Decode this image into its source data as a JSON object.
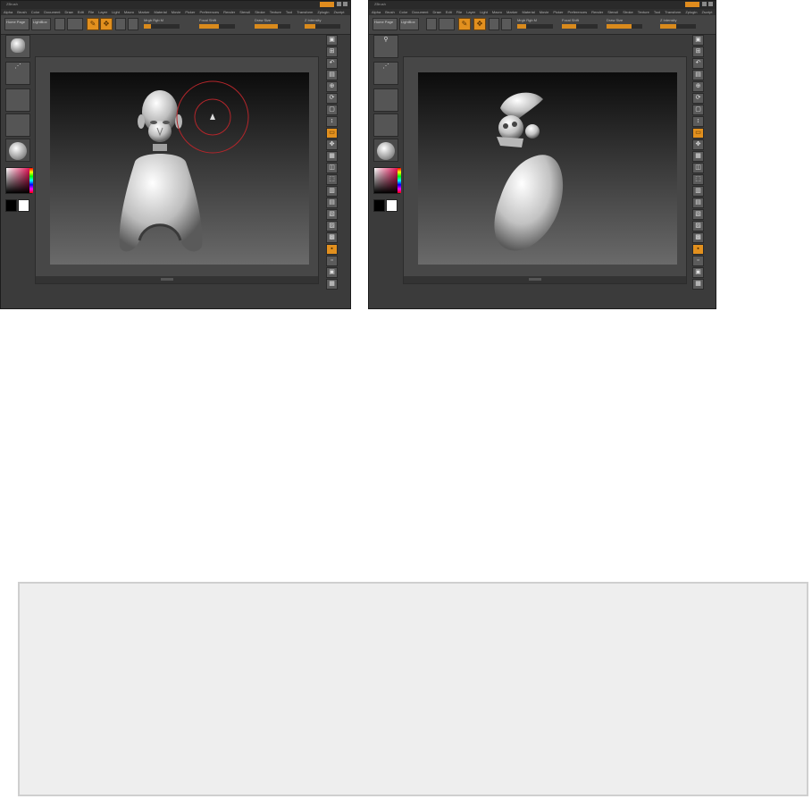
{
  "screenshots": [
    {
      "id": "left",
      "title": "ZBrush",
      "menu": [
        "Alpha",
        "Brush",
        "Color",
        "Document",
        "Draw",
        "Edit",
        "File",
        "Layer",
        "Light",
        "Macro",
        "Marker",
        "Material",
        "Movie",
        "Picker",
        "Preferences",
        "Render",
        "Stencil",
        "Stroke",
        "Texture",
        "Tool",
        "Transform",
        "Zplugin",
        "Zscript"
      ],
      "toolbar": {
        "buttons": [
          "Home Page",
          "LightBox"
        ],
        "sliders": [
          {
            "label": "Focal Shift",
            "value": 0.55
          },
          {
            "label": "Draw Size",
            "value": 0.65
          },
          {
            "label": "Z Intensity",
            "value": 0.3
          },
          {
            "label": "Rgb Intensity",
            "value": 0.2
          }
        ]
      },
      "scene": "head + shoulder subtools with brush cursor",
      "brush_cursor_color": "#b3262b"
    },
    {
      "id": "right",
      "title": "ZBrush",
      "menu": [
        "Alpha",
        "Brush",
        "Color",
        "Document",
        "Draw",
        "Edit",
        "File",
        "Layer",
        "Light",
        "Macro",
        "Marker",
        "Material",
        "Movie",
        "Picker",
        "Preferences",
        "Render",
        "Stencil",
        "Stroke",
        "Texture",
        "Tool",
        "Transform",
        "Zplugin",
        "Zscript"
      ],
      "toolbar": {
        "buttons": [
          "Home Page",
          "LightBox"
        ],
        "sliders": [
          {
            "label": "Focal Shift",
            "value": 0.4
          },
          {
            "label": "Draw Size",
            "value": 0.7
          },
          {
            "label": "Z Intensity",
            "value": 0.45
          },
          {
            "label": "Rgb Intensity",
            "value": 0.25
          }
        ]
      },
      "scene": "rotated skull and egg-shaped subtool"
    }
  ],
  "accent": "#e2901e",
  "icons": {
    "undo": "↶",
    "redo": "↷",
    "move": "✥",
    "zoom": "⊕",
    "rotate": "⟳",
    "frame": "▣",
    "floor": "▤",
    "grid": "#"
  }
}
